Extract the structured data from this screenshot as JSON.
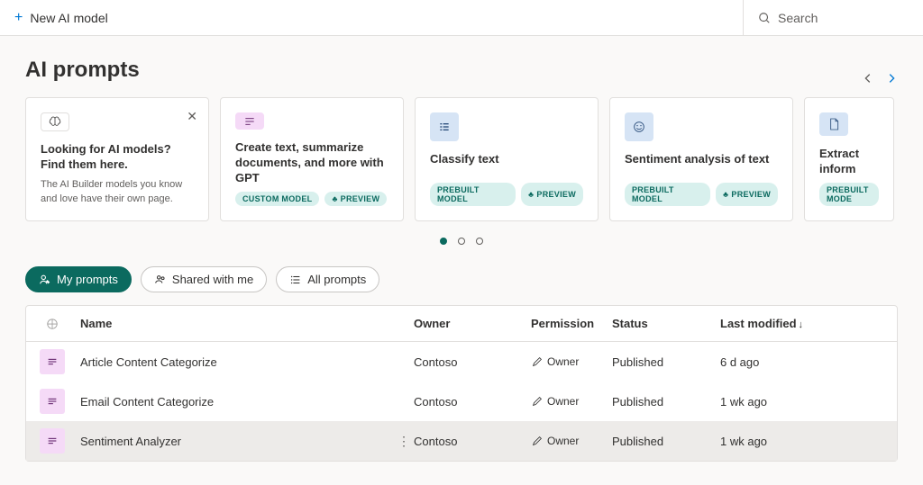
{
  "topbar": {
    "new_model_label": "New AI model",
    "search_placeholder": "Search"
  },
  "page": {
    "title": "AI prompts"
  },
  "cards": [
    {
      "id": "info",
      "title": "Looking for AI models? Find them here.",
      "desc": "The AI Builder models you know and love have their own page.",
      "icon": "brain-icon",
      "closable": true
    },
    {
      "id": "gpt",
      "title": "Create text, summarize documents, and more with GPT",
      "icon": "text-lines-icon",
      "badges": [
        "CUSTOM MODEL",
        "PREVIEW"
      ]
    },
    {
      "id": "classify",
      "title": "Classify text",
      "icon": "list-grid-icon",
      "badges": [
        "PREBUILT MODEL",
        "PREVIEW"
      ]
    },
    {
      "id": "sentiment",
      "title": "Sentiment analysis of text",
      "icon": "smile-icon",
      "badges": [
        "PREBUILT MODEL",
        "PREVIEW"
      ]
    },
    {
      "id": "extract",
      "title": "Extract inform",
      "icon": "document-icon",
      "badges": [
        "PREBUILT MODE"
      ]
    }
  ],
  "tabs": {
    "my_prompts": "My prompts",
    "shared": "Shared with me",
    "all": "All prompts"
  },
  "columns": {
    "name": "Name",
    "owner": "Owner",
    "permission": "Permission",
    "status": "Status",
    "last_modified": "Last modified"
  },
  "rows": [
    {
      "name": "Article Content Categorize",
      "owner": "Contoso",
      "permission": "Owner",
      "status": "Published",
      "modified": "6 d ago"
    },
    {
      "name": "Email Content Categorize",
      "owner": "Contoso",
      "permission": "Owner",
      "status": "Published",
      "modified": "1 wk ago"
    },
    {
      "name": "Sentiment Analyzer",
      "owner": "Contoso",
      "permission": "Owner",
      "status": "Published",
      "modified": "1 wk ago",
      "hovered": true
    }
  ]
}
